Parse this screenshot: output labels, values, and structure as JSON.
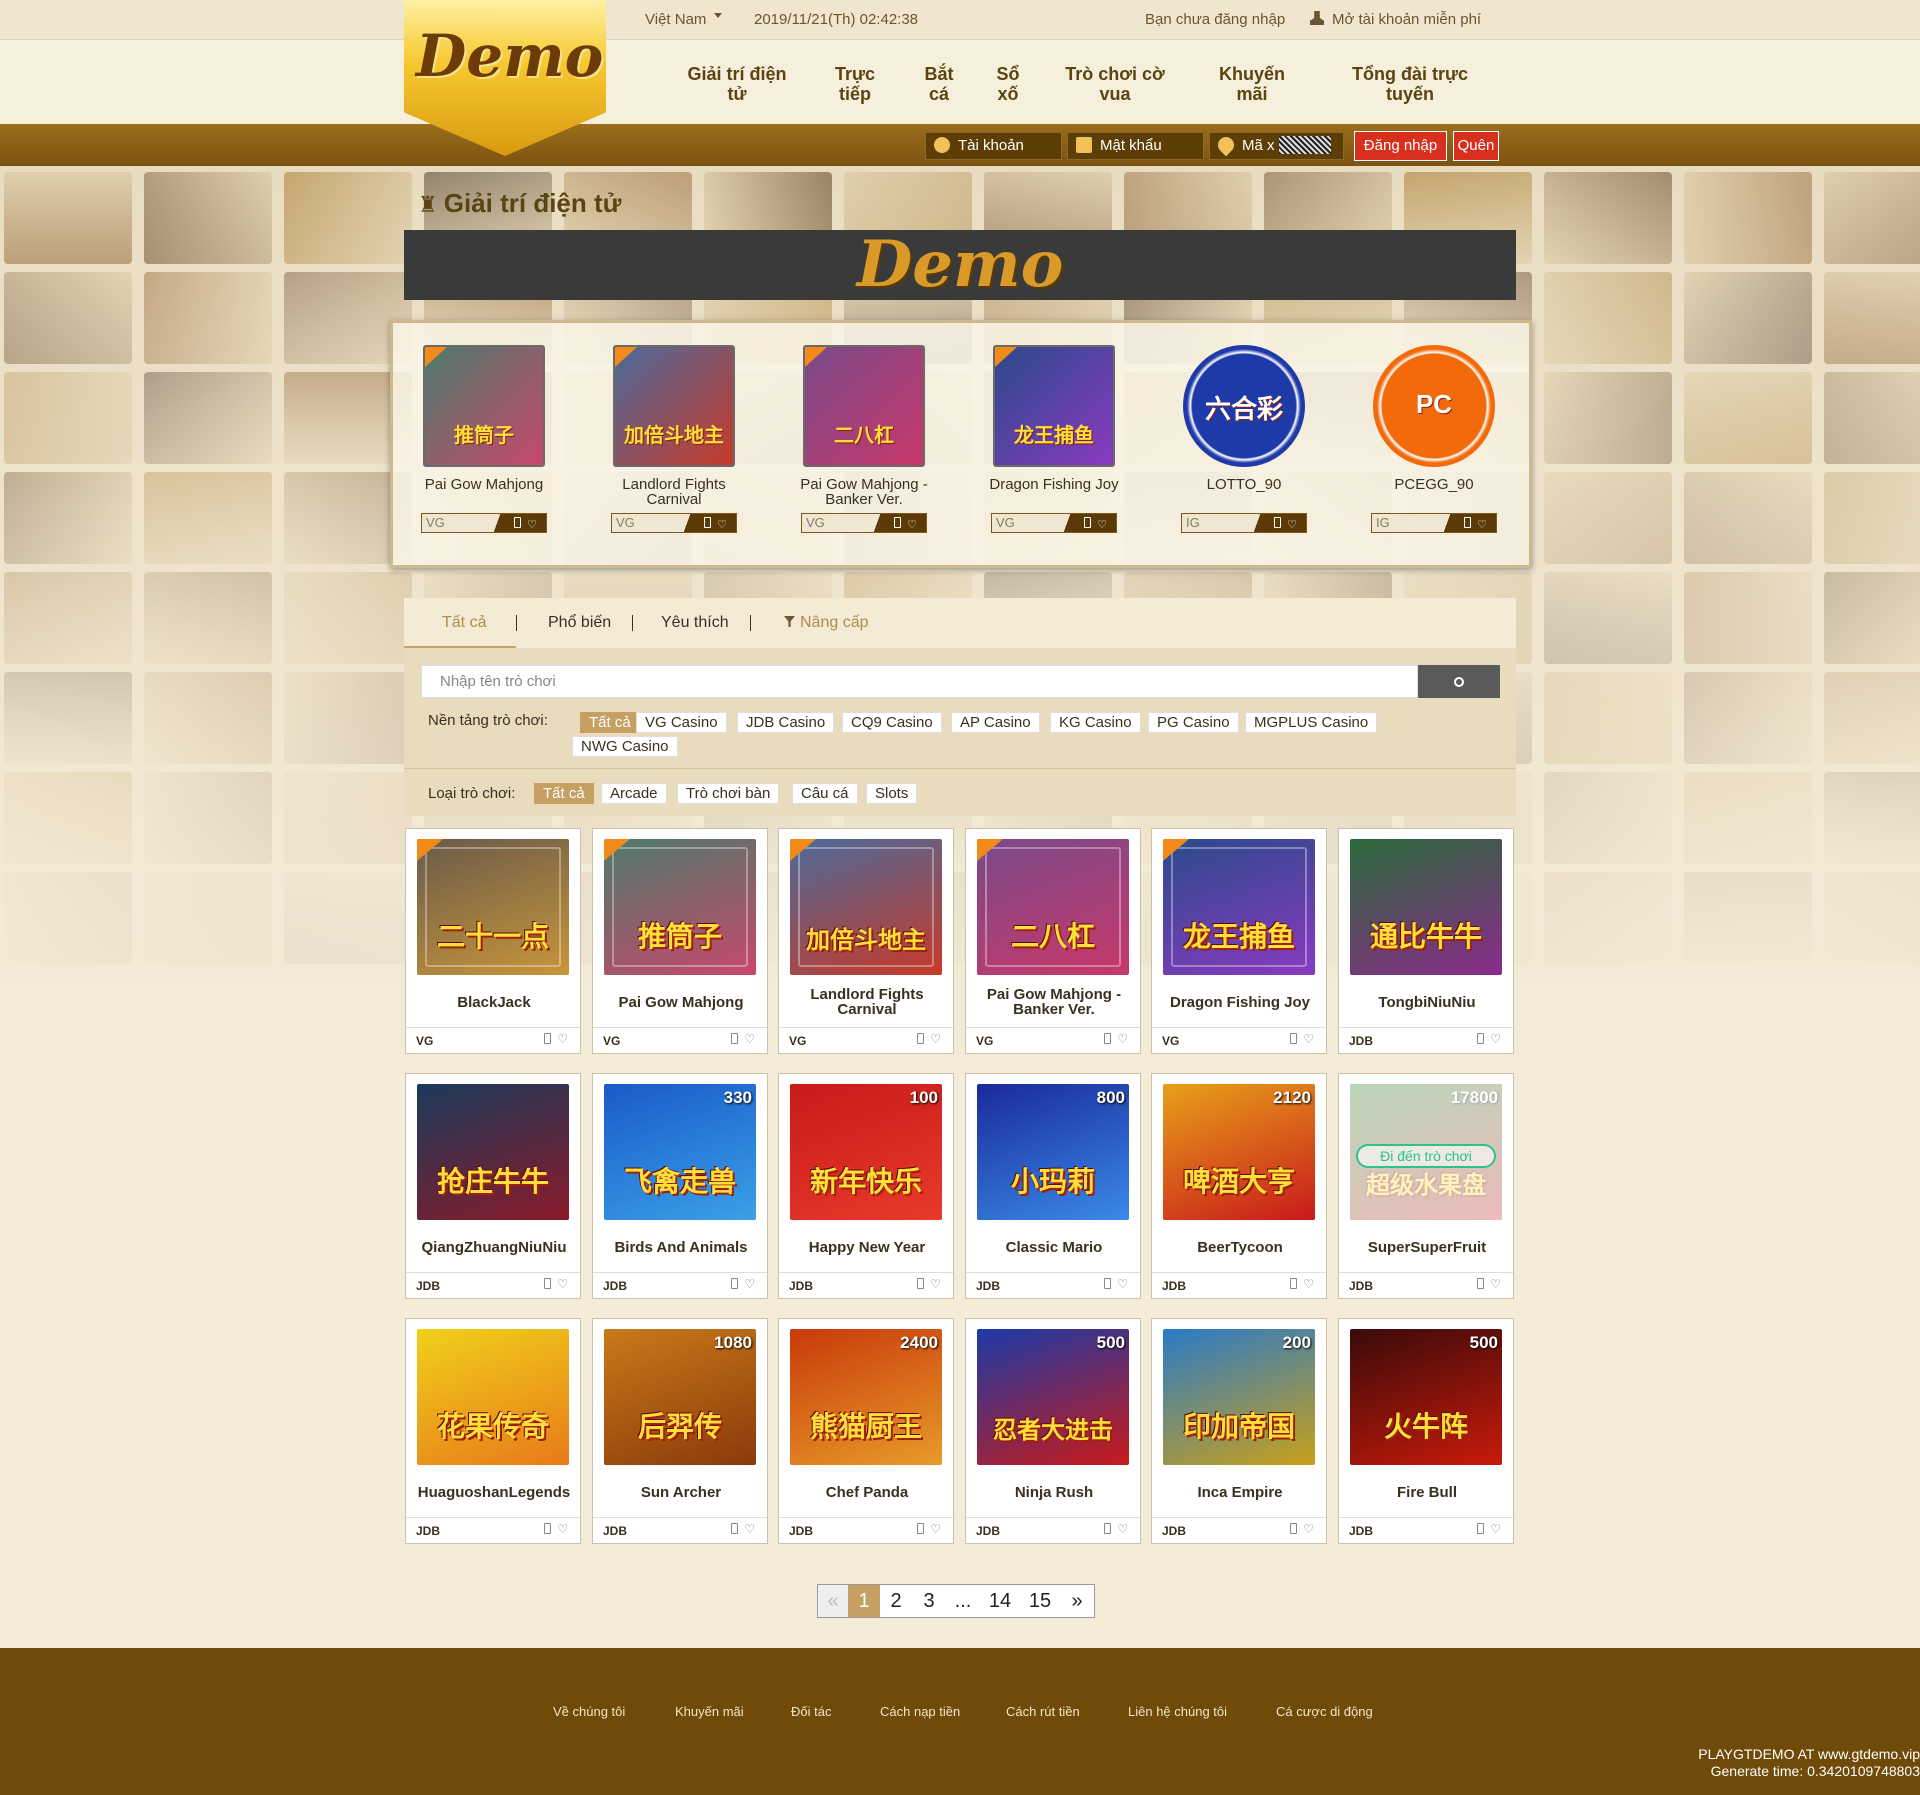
{
  "header": {
    "region": "Việt Nam",
    "datetime": "2019/11/21(Th) 02:42:38",
    "not_logged_in": "Bạn chưa đăng nhập",
    "register": "Mở tài khoản miễn phí",
    "logo": "Demo"
  },
  "nav": {
    "items": [
      "Giải trí điện tử",
      "Trực tiếp",
      "Bắt cá",
      "Sổ xố",
      "Trò chơi cờ vua",
      "Khuyến mãi",
      "Tổng đài trực tuyến"
    ]
  },
  "login": {
    "account": "Tài khoản",
    "password": "Mật khẩu",
    "captcha": "Mã x",
    "login_button": "Đăng nhập",
    "forgot_button": "Quên"
  },
  "section": {
    "title": "Giải trí điện tử",
    "banner": "Demo"
  },
  "featured": [
    {
      "name": "Pai Gow Mahjong",
      "platform": "VG",
      "colors": [
        "#4d7a6a",
        "#c7486d"
      ],
      "art": "推筒子"
    },
    {
      "name": "Landlord Fights Carnival",
      "platform": "VG",
      "colors": [
        "#4a6a9a",
        "#c83a2a"
      ],
      "art": "加倍斗地主"
    },
    {
      "name": "Pai Gow Mahjong - Banker Ver.",
      "platform": "VG",
      "colors": [
        "#7a4a8a",
        "#c8386a"
      ],
      "art": "二八杠"
    },
    {
      "name": "Dragon Fishing Joy",
      "platform": "VG",
      "colors": [
        "#2a4a8a",
        "#8a3ac0"
      ],
      "art": "龙王捕鱼"
    },
    {
      "name": "LOTTO_90",
      "platform": "IG",
      "colors": [
        "#1e3aa8",
        "#1e3aa8"
      ],
      "art": "六合彩"
    },
    {
      "name": "PCEGG_90",
      "platform": "IG",
      "colors": [
        "#f36a0a",
        "#f36a0a"
      ],
      "art": "PC"
    }
  ],
  "tabs": [
    "Tất cả",
    "Phổ biến",
    "Yêu thích",
    "Nâng cấp"
  ],
  "search": {
    "placeholder": "Nhập tên trò chơi"
  },
  "filters": {
    "platform_label": "Nền tảng trò chơi:",
    "platforms": [
      "Tất cả",
      "VG Casino",
      "JDB Casino",
      "CQ9 Casino",
      "AP Casino",
      "KG Casino",
      "PG Casino",
      "MGPLUS Casino",
      "NWG Casino"
    ],
    "type_label": "Loại trò chơi:",
    "types": [
      "Tất cả",
      "Arcade",
      "Trò chơi bàn",
      "Câu cá",
      "Slots"
    ]
  },
  "games": [
    {
      "name": "BlackJack",
      "platform": "VG",
      "colors": [
        "#6a5a4a",
        "#c8963a"
      ],
      "art": "二十一点",
      "num": ""
    },
    {
      "name": "Pai Gow Mahjong",
      "platform": "VG",
      "colors": [
        "#4d7a6a",
        "#c7486d"
      ],
      "art": "推筒子",
      "num": ""
    },
    {
      "name": "Landlord Fights Carnival",
      "platform": "VG",
      "colors": [
        "#4a6a9a",
        "#c83a2a"
      ],
      "art": "加倍斗地主",
      "num": ""
    },
    {
      "name": "Pai Gow Mahjong - Banker Ver.",
      "platform": "VG",
      "colors": [
        "#7a4a8a",
        "#c8386a"
      ],
      "art": "二八杠",
      "num": ""
    },
    {
      "name": "Dragon Fishing Joy",
      "platform": "VG",
      "colors": [
        "#2a4a8a",
        "#8a3ac0"
      ],
      "art": "龙王捕鱼",
      "num": ""
    },
    {
      "name": "TongbiNiuNiu",
      "platform": "JDB",
      "colors": [
        "#2a6a3a",
        "#8a2a8a"
      ],
      "art": "通比牛牛",
      "num": ""
    },
    {
      "name": "QiangZhuangNiuNiu",
      "platform": "JDB",
      "colors": [
        "#1a3a5a",
        "#8a1a2a"
      ],
      "art": "抢庄牛牛",
      "num": ""
    },
    {
      "name": "Birds And Animals",
      "platform": "JDB",
      "colors": [
        "#1a5ac8",
        "#3aa0e8"
      ],
      "art": "飞禽走兽",
      "num": "330"
    },
    {
      "name": "Happy New Year",
      "platform": "JDB",
      "colors": [
        "#c81a1a",
        "#e83a2a"
      ],
      "art": "新年快乐",
      "num": "100"
    },
    {
      "name": "Classic Mario",
      "platform": "JDB",
      "colors": [
        "#1a2a9a",
        "#3a8ae8"
      ],
      "art": "小玛莉",
      "num": "800"
    },
    {
      "name": "BeerTycoon",
      "platform": "JDB",
      "colors": [
        "#e8a01a",
        "#c81a1a"
      ],
      "art": "啤酒大亨",
      "num": "2120"
    },
    {
      "name": "SuperSuperFruit",
      "platform": "JDB",
      "colors": [
        "#3a8a3a",
        "#c83a3a"
      ],
      "art": "超级水果盘",
      "num": "17800",
      "hover": "Đi đến trò chơi"
    },
    {
      "name": "HuaguoshanLegends",
      "platform": "JDB",
      "colors": [
        "#f0d01a",
        "#e87a1a"
      ],
      "art": "花果传奇",
      "num": ""
    },
    {
      "name": "Sun Archer",
      "platform": "JDB",
      "colors": [
        "#c87a1a",
        "#8a3a0a"
      ],
      "art": "后羿传",
      "num": "1080"
    },
    {
      "name": "Chef Panda",
      "platform": "JDB",
      "colors": [
        "#c83a0a",
        "#e89a2a"
      ],
      "art": "熊猫厨王",
      "num": "2400"
    },
    {
      "name": "Ninja Rush",
      "platform": "JDB",
      "colors": [
        "#1a3aa8",
        "#c81a1a"
      ],
      "art": "忍者大进击",
      "num": "500"
    },
    {
      "name": "Inca Empire",
      "platform": "JDB",
      "colors": [
        "#2a7ac8",
        "#c8a01a"
      ],
      "art": "印加帝国",
      "num": "200"
    },
    {
      "name": "Fire Bull",
      "platform": "JDB",
      "colors": [
        "#3a0a0a",
        "#c81a0a"
      ],
      "art": "火牛阵",
      "num": "500"
    }
  ],
  "pagination": [
    "«",
    "1",
    "2",
    "3",
    "...",
    "14",
    "15",
    "»"
  ],
  "footer": {
    "links": [
      "Về chúng tôi",
      "Khuyến mãi",
      "Đối tác",
      "Cách nạp tiền",
      "Cách rút tiền",
      "Liên hệ chúng tôi",
      "Cá cược di động"
    ],
    "copyright": "PLAYGTDEMO AT www.gtdemo.vip",
    "generate": "Generate time: 0.342010974880​3"
  }
}
